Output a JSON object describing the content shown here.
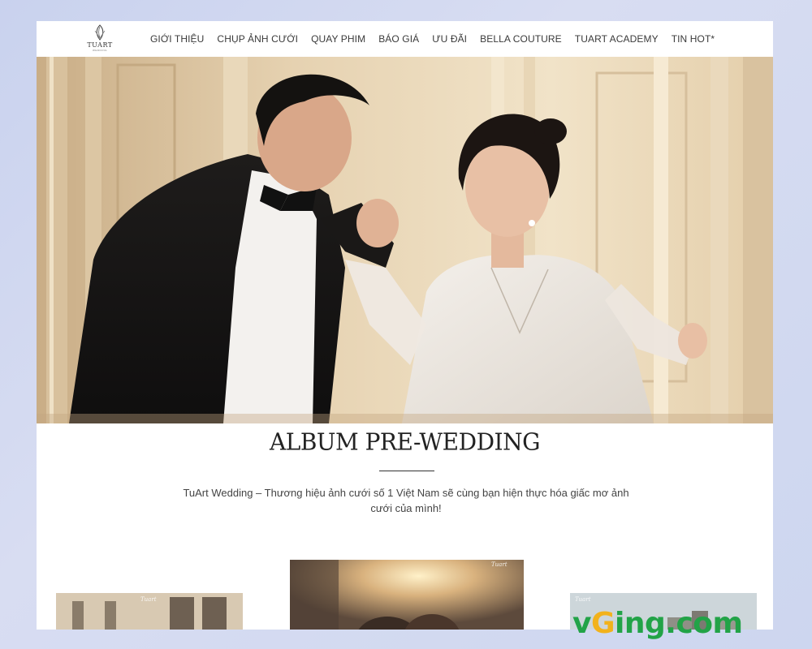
{
  "brand": {
    "logo_text": "TUART",
    "logo_sub": "WEDDING"
  },
  "nav": {
    "items": [
      "GIỚI THIỆU",
      "CHỤP ẢNH CƯỚI",
      "QUAY PHIM",
      "BÁO GIÁ",
      "ƯU ĐÃI",
      "BELLA COUTURE",
      "TUART ACADEMY",
      "TIN HOT*"
    ]
  },
  "section": {
    "title": "ALBUM PRE-WEDDING",
    "description": "TuArt Wedding – Thương hiệu ảnh cưới số 1 Việt Nam sẽ cùng bạn hiện thực hóa giấc mơ ảnh cưới của mình!"
  },
  "thumbnails": {
    "mark": "Tuart"
  },
  "watermark": {
    "pre": "v",
    "g": "G",
    "post": "ing.com"
  },
  "colors": {
    "background": "#d3d9f0",
    "watermark_green": "#22a347",
    "watermark_yellow": "#f2b21b"
  }
}
